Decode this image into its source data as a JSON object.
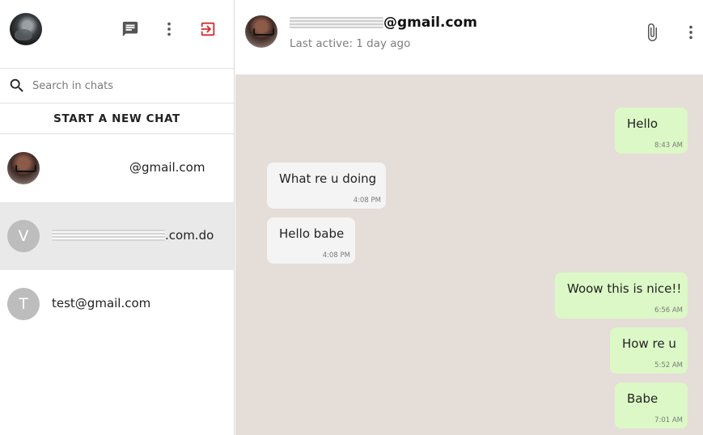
{
  "sidebar": {
    "icons": {
      "new_chat": "chat-icon",
      "more": "more-vert-icon",
      "logout": "logout-icon"
    },
    "search": {
      "placeholder": "Search in chats"
    },
    "new_chat_label": "START A NEW CHAT",
    "chats": [
      {
        "avatar_type": "photo",
        "name": "@gmail.com"
      },
      {
        "avatar_type": "initial",
        "initial": "V",
        "name": ".com.do"
      },
      {
        "avatar_type": "initial",
        "initial": "T",
        "name": "test@gmail.com"
      }
    ]
  },
  "main": {
    "header": {
      "contact_name": "@gmail.com",
      "last_active": "Last active: 1 day ago"
    },
    "messages": [
      {
        "dir": "out",
        "text": "Hello",
        "time": "8:43 AM"
      },
      {
        "dir": "in",
        "text": "What re u doing",
        "time": "4:08 PM"
      },
      {
        "dir": "in",
        "text": "Hello babe",
        "time": "4:08 PM"
      },
      {
        "dir": "out",
        "text": "Woow this is nice!!",
        "time": "6:56 AM"
      },
      {
        "dir": "out",
        "text": "How re u",
        "time": "5:52 AM"
      },
      {
        "dir": "out",
        "text": "Babe",
        "time": "7:01 AM"
      }
    ]
  },
  "colors": {
    "accent_logout": "#d32f2f",
    "incoming_bubble": "#f4f4f4",
    "outgoing_bubble": "#dcf8c6",
    "chat_background": "#e5ddd8",
    "active_row": "#e9e9ea"
  }
}
